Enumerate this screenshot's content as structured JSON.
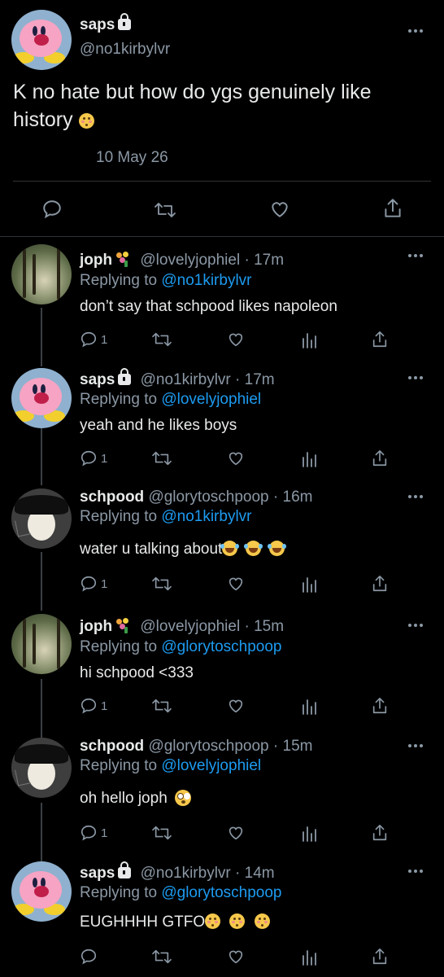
{
  "main_tweet": {
    "name": "saps",
    "handle": "@no1kirbylvr",
    "text": "K no hate but how do ygs genuinely like history",
    "date": "10 May 26",
    "avatar": "kirby-avatar"
  },
  "replies": [
    {
      "name": "joph",
      "handle": "@lovelyjophiel",
      "time": "17m",
      "replying_prefix": "Replying to",
      "replying_to": "@no1kirbylvr",
      "text": "don’t say that schpood likes napoleon",
      "reply_count": "1",
      "avatar": "forest-avatar",
      "badge": "bouquet-emoji"
    },
    {
      "name": "saps",
      "handle": "@no1kirbylvr",
      "time": "17m",
      "replying_prefix": "Replying to",
      "replying_to": "@lovelyjophiel",
      "text": "yeah and he likes boys",
      "reply_count": "1",
      "avatar": "kirby-avatar",
      "badge": "lock-icon"
    },
    {
      "name": "schpood",
      "handle": "@glorytoschpoop",
      "time": "16m",
      "replying_prefix": "Replying to",
      "replying_to": "@no1kirbylvr",
      "text": "water u talking about",
      "reply_count": "1",
      "avatar": "napoleon-avatar",
      "badge": ""
    },
    {
      "name": "joph",
      "handle": "@lovelyjophiel",
      "time": "15m",
      "replying_prefix": "Replying to",
      "replying_to": "@glorytoschpoop",
      "text": "hi schpood <333",
      "reply_count": "1",
      "avatar": "forest-avatar",
      "badge": "bouquet-emoji"
    },
    {
      "name": "schpood",
      "handle": "@glorytoschpoop",
      "time": "15m",
      "replying_prefix": "Replying to",
      "replying_to": "@lovelyjophiel",
      "text": "oh hello joph",
      "reply_count": "1",
      "avatar": "napoleon-avatar",
      "badge": ""
    },
    {
      "name": "saps",
      "handle": "@no1kirbylvr",
      "time": "14m",
      "replying_prefix": "Replying to",
      "replying_to": "@glorytoschpoop",
      "text": "EUGHHHH GTFO",
      "reply_count": "",
      "avatar": "kirby-avatar",
      "badge": "lock-icon"
    }
  ],
  "separator": "·",
  "colors": {
    "background": "#000000",
    "text": "#e7e9ea",
    "secondary": "#8b98a5",
    "link": "#1d9bf0",
    "divider": "#2f3336"
  }
}
